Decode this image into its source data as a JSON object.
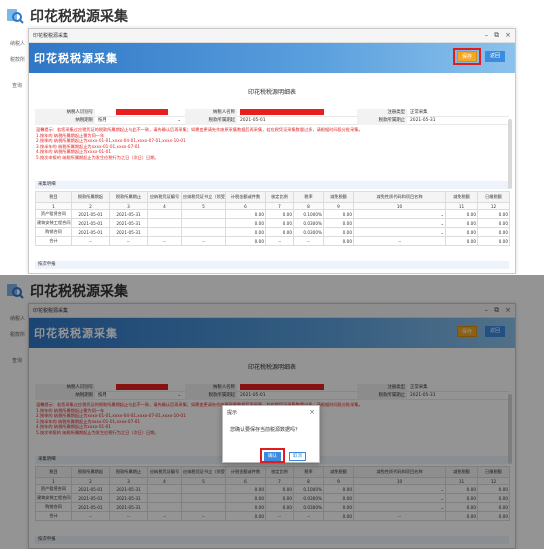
{
  "app_title": "印花税税源采集",
  "bg_labels": {
    "taxpayer": "纳税人",
    "tax_label": "税款所",
    "query": "查询"
  },
  "window": {
    "tab_title": "印花税税源采集",
    "banner_title": "印花税税源采集",
    "save_label": "保存",
    "back_label": "返回"
  },
  "doc_title": "印花税税源明细表",
  "info": {
    "taxpayer_id_label": "纳税人识别号",
    "taxpayer_name_label": "纳税人名称",
    "reg_type_label": "注册类型",
    "reg_type_value": "正常采集",
    "period_type_label": "纳税期限",
    "period_type_value": "按月",
    "period_start_label": "税款所属期起",
    "period_start_value": "2021-05-01",
    "period_end_label": "税款所属期止",
    "period_end_value": "2021-05-31"
  },
  "notes": [
    "温馨提示：若您采集过应税凭证的税款所属期起止与此不一致，请先确认后再采集；如需变更请先作废原采集数据后再采集，若应税凭证采集数量过多，请根据时间段分批采集。",
    "1.按年的 纳税所属期起止需为同一年",
    "2.按季的 纳税所属期起止为xxxx-01-01,xxxx-04-01,xxxx-07-01,xxxx-10-01",
    "3.按半年的 纳税所属期起止为xxxx-01-01,xxxx-07-01",
    "4.按年的 纳税所属期起止为xxxx-01-01",
    "5.按次申报的 纳税所属期起止为发生应税行为之日（次日）日期。"
  ],
  "section_label": "采集明细",
  "section2_label": "按次申报",
  "table": {
    "headers": [
      "税目",
      "税款所属期起",
      "税款所属期止",
      "应纳税凭证编号",
      "应纳税凭证书立（领受）日期",
      "计税金额或件数",
      "核定比例",
      "税率",
      "减免税额",
      "减免性质代码和项目名称",
      "减免税额",
      "已缴税额"
    ],
    "numbers": [
      "1",
      "2",
      "3",
      "4",
      "5",
      "6",
      "7",
      "8",
      "9",
      "10",
      "11",
      "12"
    ],
    "rows": [
      {
        "item": "资产租赁合同",
        "start": "2021-05-01",
        "end": "2021-05-31",
        "amount": "0.00",
        "ratio": "0.00",
        "rate": "0.1000%",
        "relief": "0.00",
        "relief_code": "",
        "relief_amt": "0.00",
        "paid": "0.00"
      },
      {
        "item": "建筑安装工程合同",
        "start": "2021-05-01",
        "end": "2021-05-31",
        "amount": "0.00",
        "ratio": "0.00",
        "rate": "0.0300%",
        "relief": "0.00",
        "relief_code": "",
        "relief_amt": "0.00",
        "paid": "0.00"
      },
      {
        "item": "购销合同",
        "start": "2021-05-01",
        "end": "2021-05-31",
        "amount": "0.00",
        "ratio": "0.00",
        "rate": "0.0300%",
        "relief": "0.00",
        "relief_code": "",
        "relief_amt": "0.00",
        "paid": "0.00"
      }
    ],
    "total_label": "合计",
    "total_dash": "--",
    "total_values": {
      "amount": "0.00",
      "relief": "0.00",
      "relief_amt": "0.00",
      "paid": "0.00"
    }
  },
  "dialog": {
    "title": "提示",
    "message": "您确认要保存当前税源数据吗？",
    "ok_label": "确认",
    "cancel_label": "取消"
  },
  "colors": {
    "banner": "#3b82d0",
    "save_button": "#f5a623",
    "highlight": "#e01c1c",
    "redacted": "#e81f1f"
  }
}
